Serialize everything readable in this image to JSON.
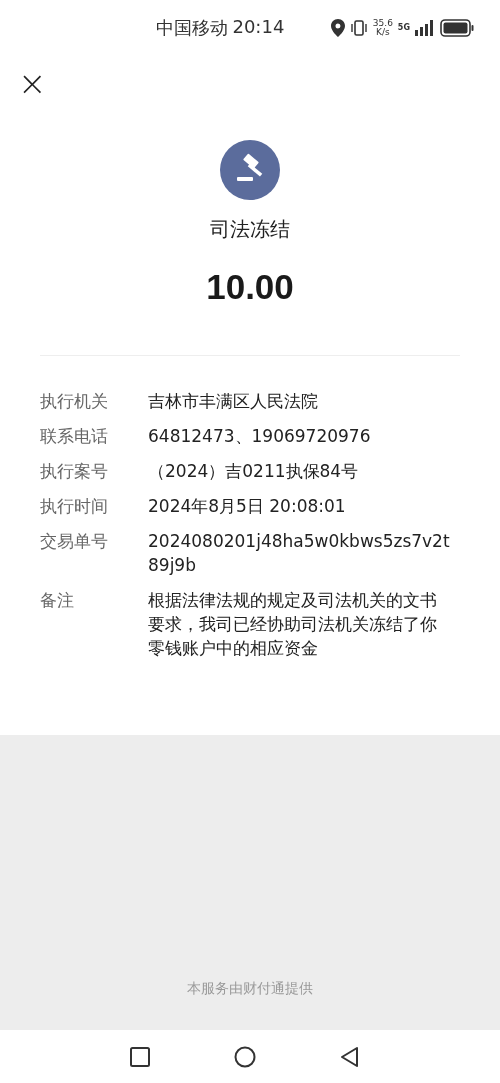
{
  "status_bar": {
    "carrier": "中国移动",
    "time": "20:14",
    "speed_value": "35.6",
    "speed_unit": "K/s",
    "network": "5G"
  },
  "header": {
    "close": "×"
  },
  "summary": {
    "title": "司法冻结",
    "amount": "10.00"
  },
  "details": [
    {
      "label": "执行机关",
      "value": "吉林市丰满区人民法院"
    },
    {
      "label": "联系电话",
      "value": "64812473、19069720976"
    },
    {
      "label": "执行案号",
      "value": "（2024）吉0211执保84号"
    },
    {
      "label": "执行时间",
      "value": "2024年8月5日 20:08:01"
    },
    {
      "label": "交易单号",
      "value": "2024080201j48ha5w0kbws5zs7v2t89j9b"
    },
    {
      "label": "备注",
      "value": "根据法律法规的规定及司法机关的文书要求，我司已经协助司法机关冻结了你零钱账户中的相应资金"
    }
  ],
  "footer": {
    "provider": "本服务由财付通提供"
  }
}
